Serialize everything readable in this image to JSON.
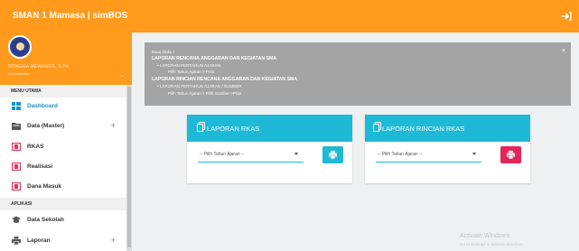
{
  "app": {
    "title": "SMAN 1 Mamasa | simBOS"
  },
  "profile": {
    "name": "SONGGA MEWANGA, S.Pd.",
    "role": "Administrator"
  },
  "sidebar": {
    "section_main": "MENU UTAMA",
    "section_apps": "APLIKASI",
    "items": [
      {
        "label": "Dashboard",
        "icon": "dashboard-icon",
        "active": true,
        "expandable": false
      },
      {
        "label": "Data (Master)",
        "icon": "folder-icon",
        "active": false,
        "expandable": true
      },
      {
        "label": "RKAS",
        "icon": "book-icon",
        "active": false,
        "expandable": false
      },
      {
        "label": "Realisasi",
        "icon": "book-icon",
        "active": false,
        "expandable": false
      },
      {
        "label": "Dana Masuk",
        "icon": "book-icon",
        "active": false,
        "expandable": false
      }
    ],
    "app_items": [
      {
        "label": "Data Sekolah",
        "icon": "school-icon",
        "expandable": false
      },
      {
        "label": "Laporan",
        "icon": "printer-icon",
        "expandable": true
      }
    ],
    "plus_symbol": "+"
  },
  "alert": {
    "close": "×",
    "greeting": "Baca Duku !",
    "heading1": "LAPORAN RENCANA ANGGARAN DAN KEGIATAN SMA",
    "bullet1": "• LAPORAN PERTAHUN AJARAN",
    "step1": "Pilih Tahun Ajaran > Print",
    "heading2": "LAPORAN RINCIAN RENCANA ANGGARAN DAN KEGIATAN SMA",
    "bullet2": "• LAPORAN PERTAHUN AJARAN / SUMBER",
    "step2": "Pilih Tahun Ajaran > Pilih Sumber >Print"
  },
  "cards": [
    {
      "title": "LAPORAN RKAS",
      "select_value": "-- Pilih Tahun Ajaran --",
      "button_color": "#1eb9d7"
    },
    {
      "title": "LAPORAN RINCIAN RKAS",
      "select_value": "-- Pilih Tahun Ajaran --",
      "button_color": "#e7245a"
    }
  ],
  "watermark": {
    "line1": "Activate Windows",
    "line2": "Go to Settings to activate Windows."
  },
  "colors": {
    "brand": "#ff9a1c",
    "accent": "#1eb9d7",
    "danger": "#e7245a",
    "alert_bg": "#a4a4a4"
  }
}
